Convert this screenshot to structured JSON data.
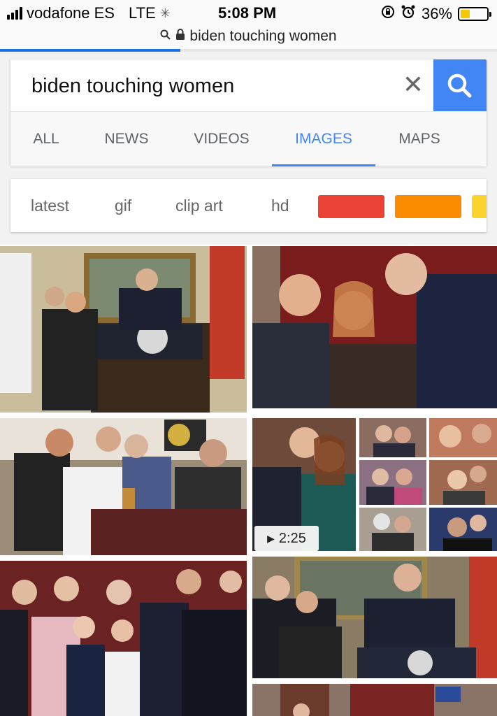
{
  "status": {
    "carrier": "vodafone ES",
    "network": "LTE",
    "time": "5:08 PM",
    "battery": "36%",
    "battery_level": 0.36
  },
  "url": {
    "text": "biden touching women"
  },
  "search": {
    "query": "biden touching women"
  },
  "tabs": [
    {
      "label": "ALL"
    },
    {
      "label": "NEWS"
    },
    {
      "label": "VIDEOS"
    },
    {
      "label": "IMAGES",
      "active": true
    },
    {
      "label": "MAPS"
    }
  ],
  "chips": [
    {
      "label": "latest"
    },
    {
      "label": "gif"
    },
    {
      "label": "clip art"
    },
    {
      "label": "hd"
    }
  ],
  "color_chips": [
    "#ea4335",
    "#fb8c00",
    "#fbd32e"
  ],
  "results": {
    "video_duration": "2:25"
  },
  "colors": {
    "accent": "#4285f4"
  }
}
